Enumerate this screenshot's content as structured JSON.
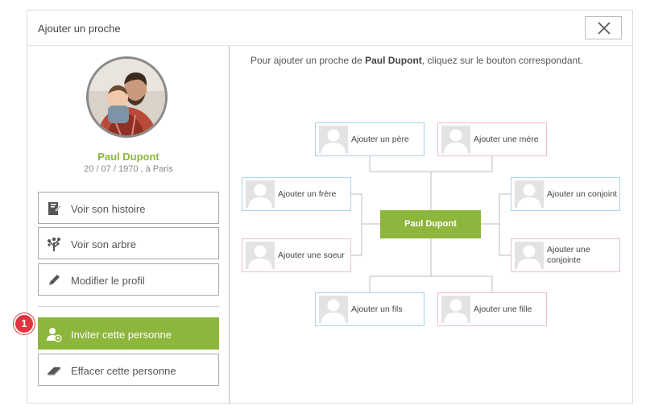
{
  "dialog": {
    "title": "Ajouter un proche",
    "close_icon": "close-icon"
  },
  "profile": {
    "name": "Paul Dupont",
    "dates": "20 / 07 / 1970 , à Paris"
  },
  "actions": {
    "history": {
      "label": "Voir son histoire",
      "icon": "book-icon"
    },
    "tree": {
      "label": "Voir son arbre",
      "icon": "tree-icon"
    },
    "edit": {
      "label": "Modifier le profil",
      "icon": "pencil-icon"
    },
    "invite": {
      "label": "Inviter cette personne",
      "icon": "user-add-icon"
    },
    "erase": {
      "label": "Effacer cette personne",
      "icon": "eraser-icon"
    }
  },
  "step_badge": "1",
  "instruction": {
    "prefix": "Pour ajouter un proche de ",
    "name": "Paul Dupont",
    "suffix": ", cliquez sur le bouton correspondant."
  },
  "tree": {
    "center": "Paul Dupont",
    "father": "Ajouter un père",
    "mother": "Ajouter une mère",
    "brother": "Ajouter un frère",
    "sister": "Ajouter une soeur",
    "spouse_m": "Ajouter un conjoint",
    "spouse_f": "Ajouter une conjointe",
    "son": "Ajouter un fils",
    "daughter": "Ajouter une fille"
  },
  "colors": {
    "accent": "#8db63c",
    "badge": "#e0353f",
    "male_border": "#a8d4ec",
    "female_border": "#efbcd6"
  }
}
